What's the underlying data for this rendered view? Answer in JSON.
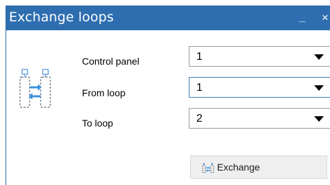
{
  "window": {
    "title": "Exchange loops",
    "minimize_glyph": "_",
    "close_glyph": "×"
  },
  "form": {
    "fields": [
      {
        "label": "Control panel",
        "value": "1"
      },
      {
        "label": "From loop",
        "value": "1"
      },
      {
        "label": "To loop",
        "value": "2"
      }
    ]
  },
  "actions": {
    "exchange_label": "Exchange"
  },
  "icons": {
    "header_icon": "loop-exchange-icon",
    "button_icon": "exchange-small-icon",
    "dropdown_arrow": "chevron-down-icon"
  },
  "colors": {
    "titlebar": "#2e6eb0",
    "accent_arrows": "#3b8fde",
    "focused_border": "#3d7bbf"
  }
}
